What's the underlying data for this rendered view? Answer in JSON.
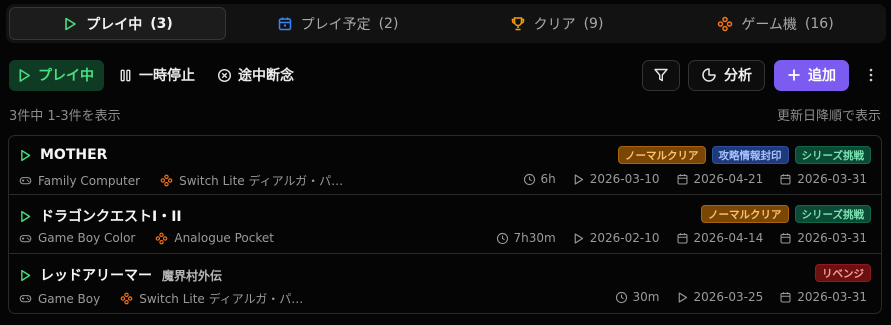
{
  "tabs": [
    {
      "label": "プレイ中",
      "count": "(3)",
      "icon": "play-icon",
      "color": "#4ade80"
    },
    {
      "label": "プレイ予定",
      "count": "(2)",
      "icon": "calendar-icon",
      "color": "#3b82f6"
    },
    {
      "label": "クリア",
      "count": "(9)",
      "icon": "trophy-icon",
      "color": "#f59e0b"
    },
    {
      "label": "ゲーム機",
      "count": "(16)",
      "icon": "gamepad-icon",
      "color": "#f97316"
    }
  ],
  "toolbar": {
    "filters": [
      "プレイ中",
      "一時停止",
      "途中断念"
    ],
    "stats_label": "分析",
    "add_label": "追加"
  },
  "info": {
    "count_text": "3件中 1-3件を表示",
    "sort_text": "更新日降順で表示"
  },
  "items": [
    {
      "title": "MOTHER",
      "subtitle": "",
      "badges": [
        {
          "label": "ノーマルクリア",
          "kind": "orange"
        },
        {
          "label": "攻略情報封印",
          "kind": "blue"
        },
        {
          "label": "シリーズ挑戦",
          "kind": "green"
        }
      ],
      "platform": "Family Computer",
      "device": "Switch Lite ディアルガ・パ…",
      "playtime": "6h",
      "started": "2026-03-10",
      "updated": "2026-04-21",
      "created": "2026-03-31"
    },
    {
      "title": "ドラゴンクエストI・II",
      "subtitle": "",
      "badges": [
        {
          "label": "ノーマルクリア",
          "kind": "orange"
        },
        {
          "label": "シリーズ挑戦",
          "kind": "green"
        }
      ],
      "platform": "Game Boy Color",
      "device": "Analogue Pocket",
      "playtime": "7h30m",
      "started": "2026-02-10",
      "updated": "2026-04-14",
      "created": "2026-03-31"
    },
    {
      "title": "レッドアリーマー",
      "subtitle": "魔界村外伝",
      "badges": [
        {
          "label": "リベンジ",
          "kind": "red"
        }
      ],
      "platform": "Game Boy",
      "device": "Switch Lite ディアルガ・パ…",
      "playtime": "30m",
      "started": "2026-03-25",
      "updated": "",
      "created": "2026-03-31"
    }
  ]
}
